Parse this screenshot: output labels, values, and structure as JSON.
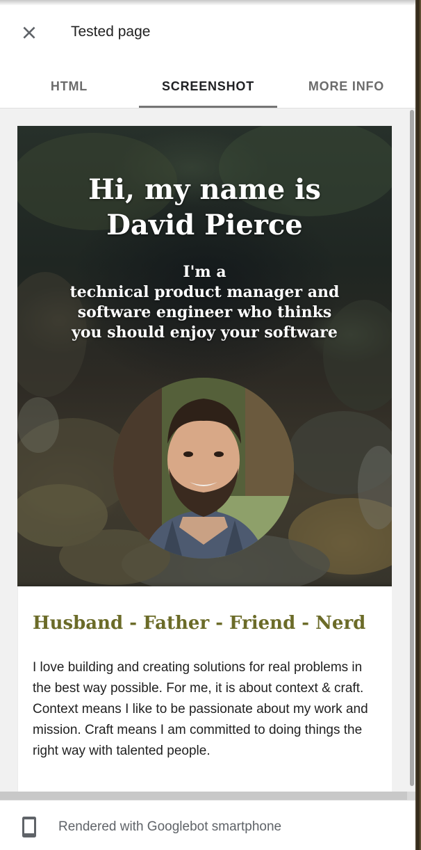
{
  "header": {
    "title": "Tested page",
    "close_icon": "close-icon"
  },
  "tabs": [
    {
      "label": "HTML",
      "active": false
    },
    {
      "label": "SCREENSHOT",
      "active": true
    },
    {
      "label": "MORE INFO",
      "active": false
    }
  ],
  "screenshot": {
    "hero": {
      "title_lines": [
        "Hi, my name is",
        "David Pierce"
      ],
      "subtitle_lines": [
        "I'm a",
        "technical product manager and",
        "software engineer who thinks",
        "you should enjoy your software"
      ],
      "avatar_icon": "portrait-photo"
    },
    "card": {
      "heading": "Husband - Father - Friend - Nerd",
      "body": "I love building and creating solutions for real problems in the best way possible. For me, it is about context & craft. Context means I like to be passionate about my work and mission. Craft means I am committed to doing things the right way with talented people."
    }
  },
  "footer": {
    "device_icon": "smartphone-icon",
    "text": "Rendered with Googlebot smartphone"
  },
  "colors": {
    "accent_heading": "#6b6b28",
    "tab_underline": "#757575",
    "text_primary": "#212121",
    "text_secondary": "#5f6368"
  }
}
